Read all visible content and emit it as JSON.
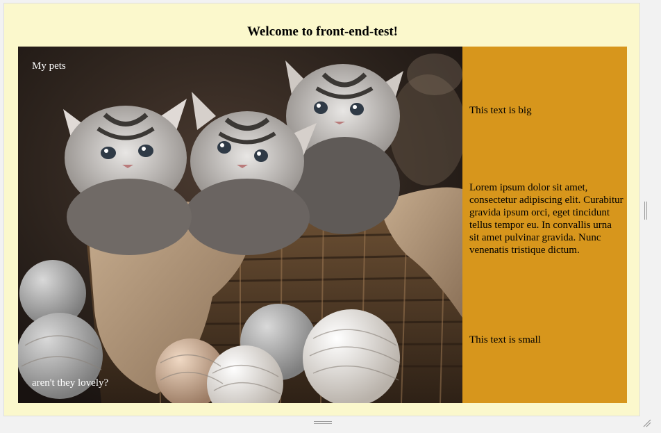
{
  "page": {
    "title": "Welcome to front-end-test!"
  },
  "hero": {
    "caption_top": "My pets",
    "caption_bottom": "aren't they lovely?",
    "image_subject": "three kittens in a wicker basket with yarn balls"
  },
  "side": {
    "big_text": "This text is big",
    "lorem": "Lorem ipsum dolor sit amet, consectetur adipiscing elit. Curabitur gravida ipsum orci, eget tincidunt tellus tempor eu. In convallis urna sit amet pulvinar gravida. Nunc venenatis tristique dictum.",
    "small_text": "This text is small"
  },
  "colors": {
    "page_background": "#fbf8cc",
    "sidebar_background": "#d7961c",
    "caption_text": "#ffffff"
  },
  "icons": {
    "vertical_resize": "vertical-resize-grip-icon",
    "horizontal_resize": "horizontal-resize-grip-icon",
    "corner_resize": "corner-resize-icon"
  }
}
